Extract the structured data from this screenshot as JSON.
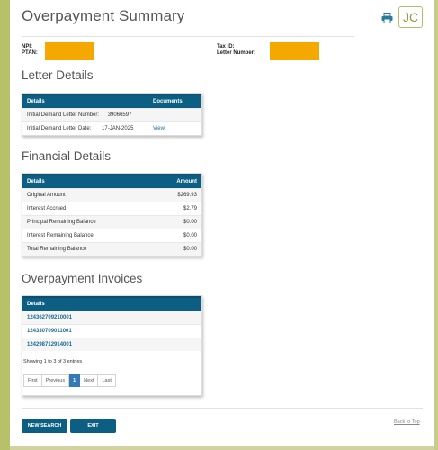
{
  "page": {
    "title": "Overpayment Summary"
  },
  "user": {
    "initials": "JC"
  },
  "colors": {
    "accent": "#0c5e82",
    "sidebar": "#b7c16a",
    "redaction": "#f5a800",
    "active_page": "#337ab7"
  },
  "icons": {
    "print": "printer-icon"
  },
  "provider": {
    "npi_label": "NPI:",
    "ptan_label": "PTAN:",
    "tax_id_label": "Tax ID:",
    "letter_number_label": "Letter Number:"
  },
  "letter_details": {
    "heading": "Letter Details",
    "columns": [
      "Details",
      "Documents"
    ],
    "rows": [
      {
        "label": "Initial Demand Letter Number:",
        "value": "39066597",
        "doc": ""
      },
      {
        "label": "Initial Demand Letter Date:",
        "value": "17-JAN-2025",
        "doc": "View"
      }
    ]
  },
  "financial_details": {
    "heading": "Financial Details",
    "columns": [
      "Details",
      "Amount"
    ],
    "rows": [
      {
        "label": "Original Amount",
        "amount": "$269.93"
      },
      {
        "label": "Interest Accrued",
        "amount": "$2.79"
      },
      {
        "label": "Principal Remaining Balance",
        "amount": "$0.00"
      },
      {
        "label": "Interest Remaining Balance",
        "amount": "$0.00"
      },
      {
        "label": "Total Remaining Balance",
        "amount": "$0.00"
      }
    ]
  },
  "invoices": {
    "heading": "Overpayment Invoices",
    "columns": [
      "Details"
    ],
    "rows": [
      "124362709210001",
      "124330709011001",
      "124298712914001"
    ],
    "showing": "Showing 1 to 3 of 3 entries",
    "pagination": {
      "first": "First",
      "previous": "Previous",
      "current": "1",
      "next": "Next",
      "last": "Last"
    }
  },
  "footer": {
    "new_search": "NEW SEARCH",
    "exit": "EXIT",
    "back_to_top": "Back to Top"
  }
}
